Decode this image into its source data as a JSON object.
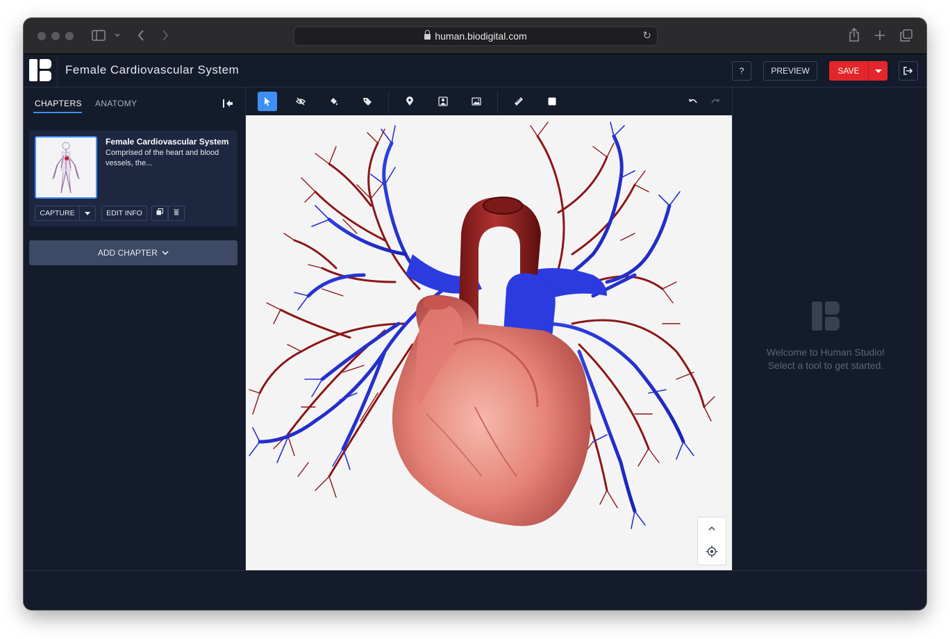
{
  "browser": {
    "url": "human.biodigital.com"
  },
  "app": {
    "title": "Female Cardiovascular System",
    "help_label": "?",
    "preview_label": "PREVIEW",
    "save_label": "SAVE",
    "accent": "#3e8ef7",
    "save_color": "#e2262b"
  },
  "sidebar": {
    "tabs": [
      {
        "label": "CHAPTERS",
        "active": true
      },
      {
        "label": "ANATOMY",
        "active": false
      }
    ],
    "chapters": [
      {
        "title": "Female Cardiovascular System",
        "description": "Comprised of the heart and blood vessels, the...",
        "capture_label": "CAPTURE",
        "edit_label": "EDIT INFO"
      }
    ],
    "add_chapter_label": "ADD CHAPTER"
  },
  "toolbar": {
    "tools": [
      "select-icon",
      "hide-icon",
      "paint-icon",
      "label-icon",
      "pin-icon",
      "xray-icon",
      "image-icon",
      "ruler-icon",
      "box-icon"
    ],
    "active_tool": "select-icon"
  },
  "right_panel": {
    "welcome_line1": "Welcome to Human Studio!",
    "welcome_line2": "Select a tool to get started."
  }
}
